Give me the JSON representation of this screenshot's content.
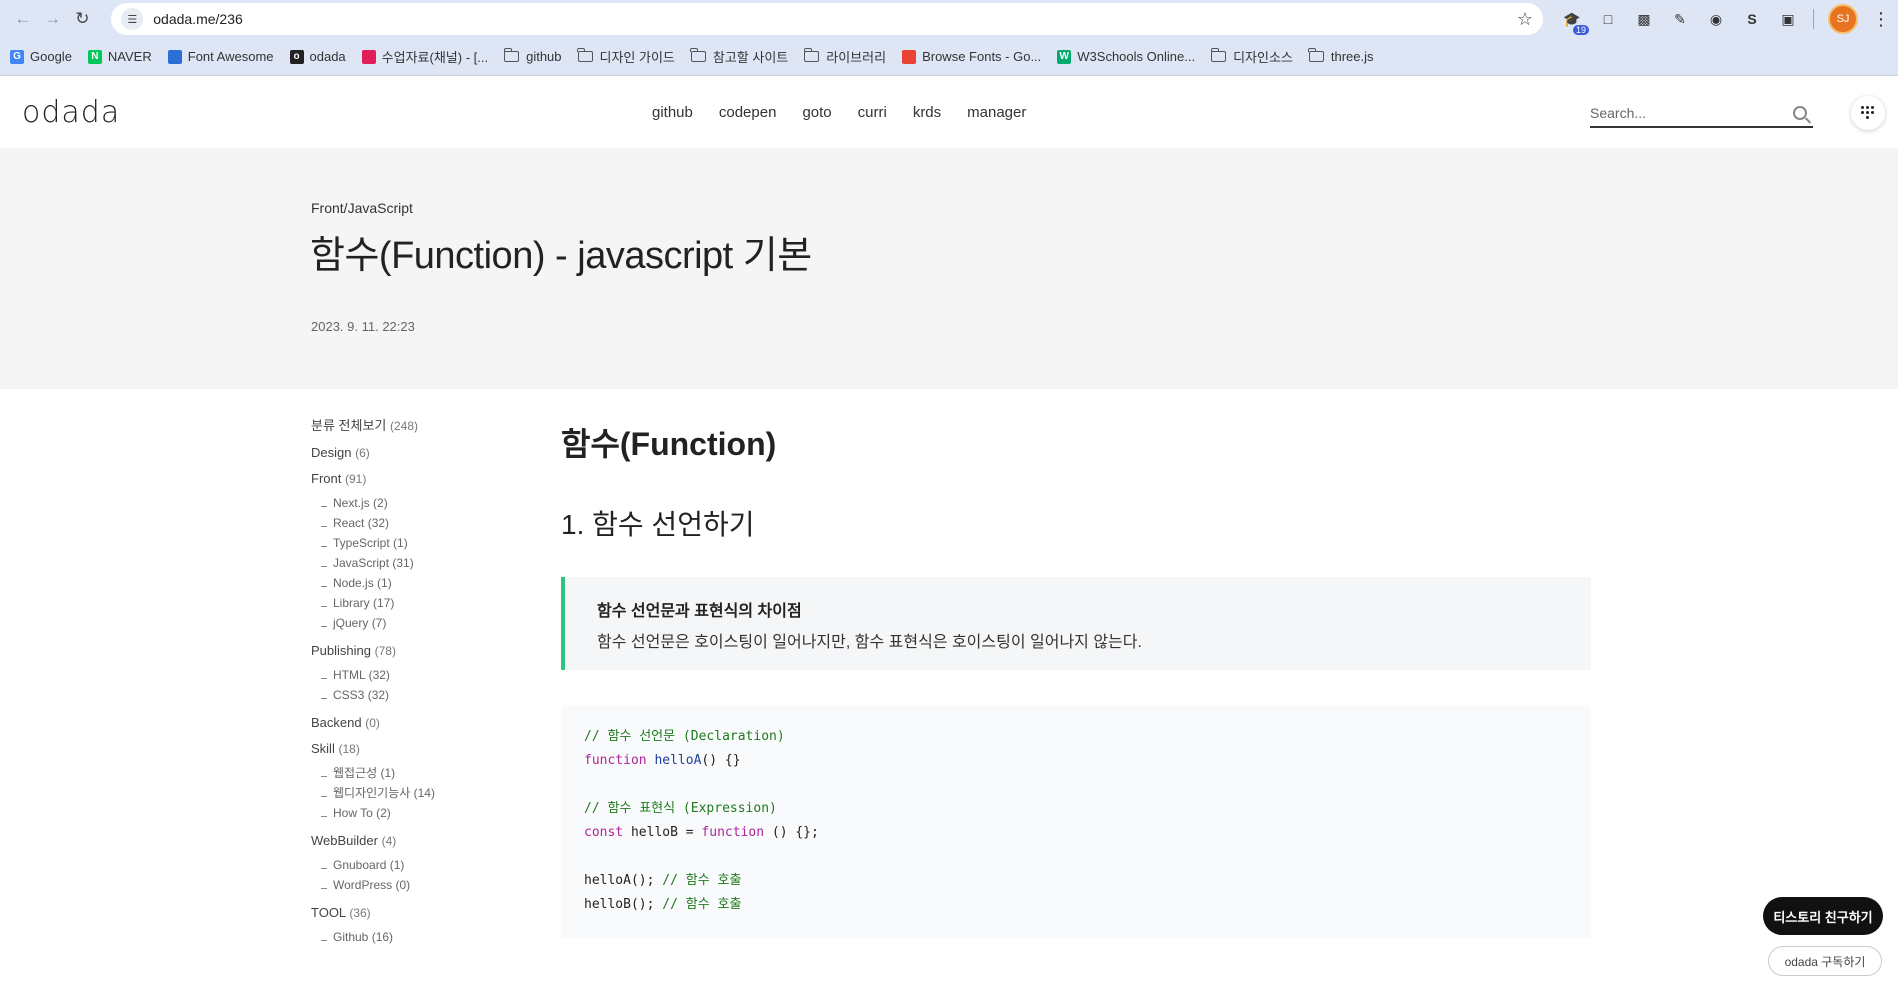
{
  "browser": {
    "url": "odada.me/236",
    "profile_initials": "SJ",
    "ext_badge": "19",
    "bookmarks": [
      {
        "label": "Google",
        "icon": "google-icon",
        "color": "#4285f4"
      },
      {
        "label": "NAVER",
        "icon": "naver-icon",
        "color": "#03c75a"
      },
      {
        "label": "Font Awesome",
        "icon": "flag-icon",
        "color": "#2b6fd6"
      },
      {
        "label": "odada",
        "icon": "odada-icon",
        "color": "#222222"
      },
      {
        "label": "수업자료(채널) - [...",
        "icon": "slack-icon",
        "color": "#e01e5a"
      },
      {
        "label": "github",
        "icon": "folder-icon"
      },
      {
        "label": "디자인 가이드",
        "icon": "folder-icon"
      },
      {
        "label": "참고할 사이트",
        "icon": "folder-icon"
      },
      {
        "label": "라이브러리",
        "icon": "folder-icon"
      },
      {
        "label": "Browse Fonts - Go...",
        "icon": "google-fonts-icon",
        "color": "#ea4335"
      },
      {
        "label": "W3Schools Online...",
        "icon": "w3schools-icon",
        "color": "#04aa6d"
      },
      {
        "label": "디자인소스",
        "icon": "folder-icon"
      },
      {
        "label": "three.js",
        "icon": "folder-icon"
      }
    ]
  },
  "site": {
    "logo": "odada",
    "nav": [
      "github",
      "codepen",
      "goto",
      "curri",
      "krds",
      "manager"
    ],
    "search_placeholder": "Search..."
  },
  "post": {
    "category": "Front/JavaScript",
    "title": "함수(Function) - javascript 기본",
    "date": "2023. 9. 11. 22:23"
  },
  "sidebar": {
    "all_label": "분류 전체보기",
    "all_count": "(248)",
    "groups": [
      {
        "label": "Design",
        "count": "(6)",
        "subs": []
      },
      {
        "label": "Front",
        "count": "(91)",
        "subs": [
          {
            "label": "Next.js",
            "count": "(2)"
          },
          {
            "label": "React",
            "count": "(32)"
          },
          {
            "label": "TypeScript",
            "count": "(1)"
          },
          {
            "label": "JavaScript",
            "count": "(31)"
          },
          {
            "label": "Node.js",
            "count": "(1)"
          },
          {
            "label": "Library",
            "count": "(17)"
          },
          {
            "label": "jQuery",
            "count": "(7)"
          }
        ]
      },
      {
        "label": "Publishing",
        "count": "(78)",
        "subs": [
          {
            "label": "HTML",
            "count": "(32)"
          },
          {
            "label": "CSS3",
            "count": "(32)"
          }
        ]
      },
      {
        "label": "Backend",
        "count": "(0)",
        "subs": []
      },
      {
        "label": "Skill",
        "count": "(18)",
        "subs": [
          {
            "label": "웹접근성",
            "count": "(1)"
          },
          {
            "label": "웹디자인기능사",
            "count": "(14)"
          },
          {
            "label": "How To",
            "count": "(2)"
          }
        ]
      },
      {
        "label": "WebBuilder",
        "count": "(4)",
        "subs": [
          {
            "label": "Gnuboard",
            "count": "(1)"
          },
          {
            "label": "WordPress",
            "count": "(0)"
          }
        ]
      },
      {
        "label": "TOOL",
        "count": "(36)",
        "subs": [
          {
            "label": "Github",
            "count": "(16)"
          }
        ]
      }
    ]
  },
  "article": {
    "h1": "함수(Function)",
    "h2": "1. 함수 선언하기",
    "callout_title": "함수 선언문과 표현식의 차이점",
    "callout_body": "함수 선언문은 호이스팅이 일어나지만, 함수 표현식은 호이스팅이 일어나지 않는다.",
    "code": [
      [
        {
          "t": "cm",
          "v": "// 함수 선언문 (Declaration)"
        }
      ],
      [
        {
          "t": "kw",
          "v": "function"
        },
        {
          "t": "pl",
          "v": " "
        },
        {
          "t": "fn",
          "v": "helloA"
        },
        {
          "t": "pl",
          "v": "() {}"
        }
      ],
      [],
      [
        {
          "t": "cm",
          "v": "// 함수 표현식 (Expression)"
        }
      ],
      [
        {
          "t": "kw",
          "v": "const"
        },
        {
          "t": "pl",
          "v": " helloB = "
        },
        {
          "t": "kw",
          "v": "function"
        },
        {
          "t": "pl",
          "v": " () {};"
        }
      ],
      [],
      [
        {
          "t": "pl",
          "v": "helloA(); "
        },
        {
          "t": "cm",
          "v": "// 함수 호출"
        }
      ],
      [
        {
          "t": "pl",
          "v": "helloB(); "
        },
        {
          "t": "cm",
          "v": "// 함수 호출"
        }
      ]
    ]
  },
  "floating": {
    "friend_label": "티스토리 친구하기",
    "subscribe_label": "odada 구독하기"
  },
  "colors": {
    "accent": "#2ec47b",
    "chrome_bg": "#dee6f5"
  }
}
